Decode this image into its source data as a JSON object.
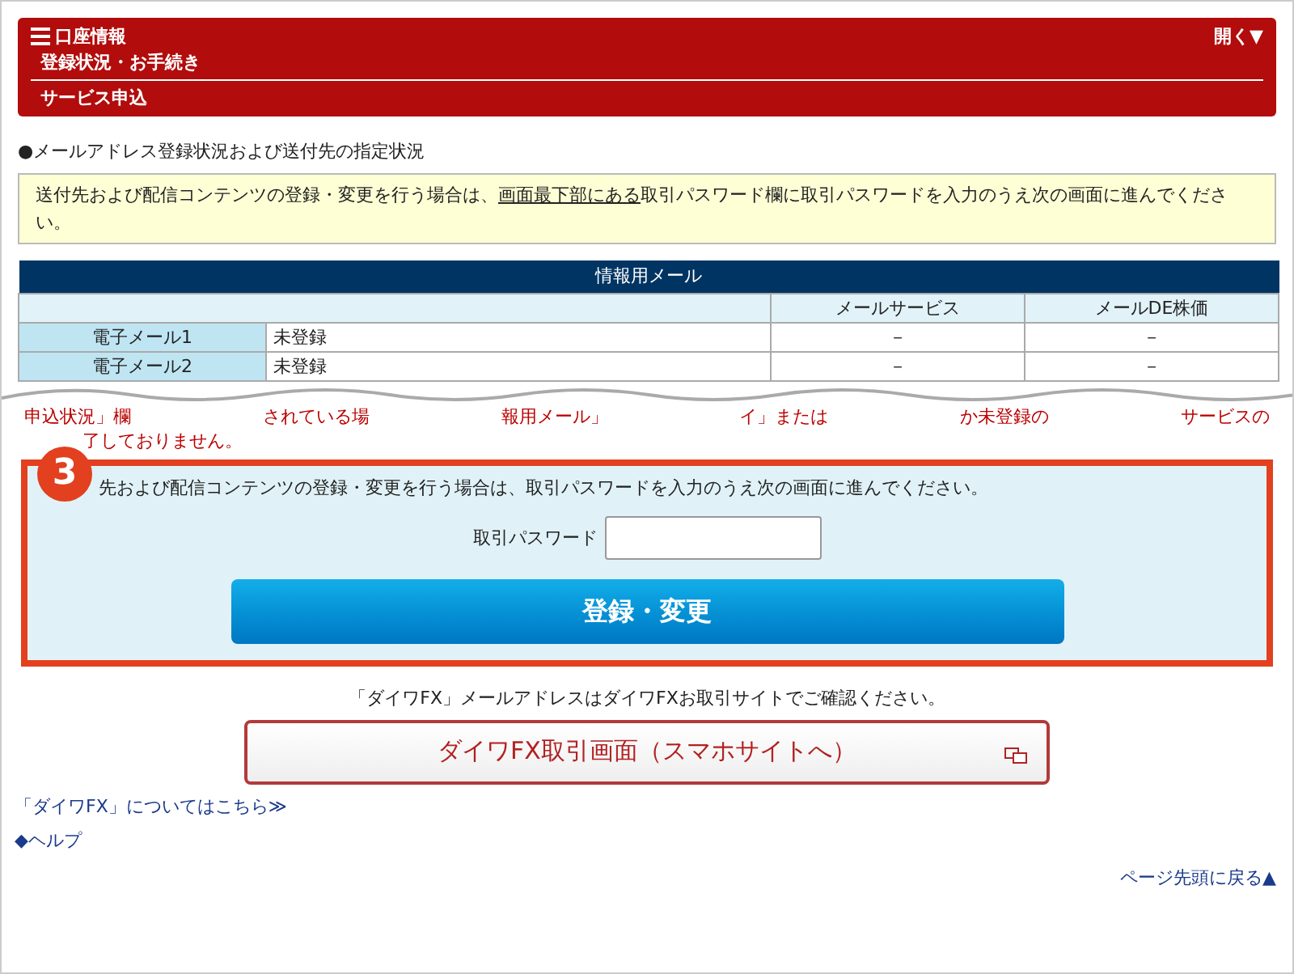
{
  "header": {
    "menu_title": "口座情報",
    "toggle": "開く▼",
    "subtitle": "登録状況・お手続き",
    "section": "サービス申込"
  },
  "heading": "●メールアドレス登録状況および送付先の指定状況",
  "notice": {
    "before": "送付先および配信コンテンツの登録・変更を行う場合は、",
    "link": "画面最下部にある",
    "after": "取引パスワード欄に取引パスワードを入力のうえ次の画面に進んでください。"
  },
  "table": {
    "title": "情報用メール",
    "columns": [
      "メールサービス",
      "メールDE株価"
    ],
    "rows": [
      {
        "label": "電子メール1",
        "status": "未登録",
        "cells": [
          "－",
          "－"
        ]
      },
      {
        "label": "電子メール2",
        "status": "未登録",
        "cells": [
          "－",
          "－"
        ]
      }
    ]
  },
  "warning_fragments": [
    "申込状況」欄",
    "されている場",
    "報用メール」",
    "イ」または",
    "か未登録の",
    "サービスの"
  ],
  "warning_tail": "了しておりません。",
  "step": {
    "badge": "3",
    "instruction": "先および配信コンテンツの登録・変更を行う場合は、取引パスワードを入力のうえ次の画面に進んでください。",
    "password_label": "取引パスワード",
    "submit": "登録・変更"
  },
  "fx": {
    "note": "「ダイワFX」メールアドレスはダイワFXお取引サイトでご確認ください。",
    "button": "ダイワFX取引画面（スマホサイトへ）"
  },
  "links": [
    "「ダイワFX」についてはこちら≫",
    "◆ヘルプ"
  ],
  "back_to_top": "ページ先頭に戻る▲"
}
